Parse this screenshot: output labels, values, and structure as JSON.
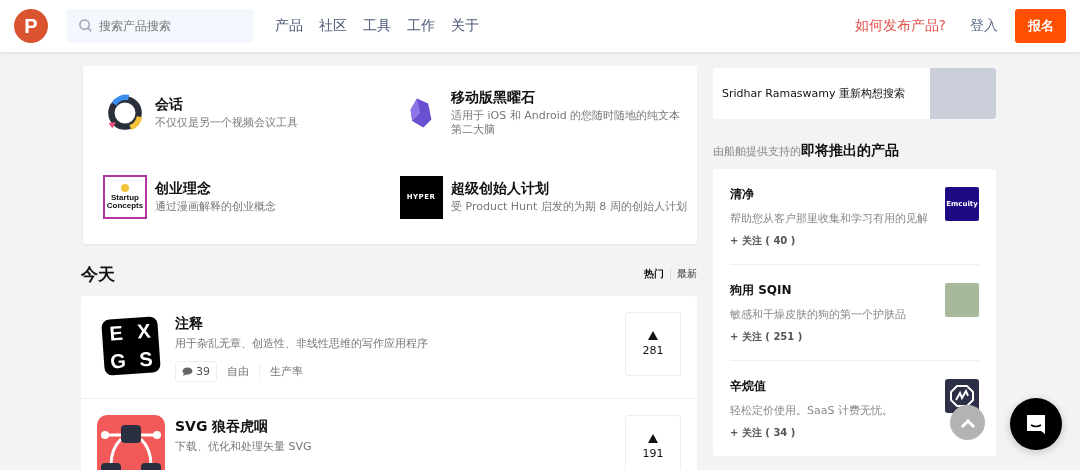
{
  "header": {
    "logo": "P",
    "search": {
      "placeholder": "搜索产品搜索"
    },
    "nav": [
      "产品",
      "社区",
      "工具",
      "工作",
      "关于"
    ],
    "how_to_launch": "如何发布产品?",
    "login": "登入",
    "signup": "报名"
  },
  "featured": [
    {
      "kind": "ring",
      "title": "会话",
      "desc": "不仅仅是另一个视频会议工具"
    },
    {
      "kind": "gem",
      "title": "移动版黑曜石",
      "desc": "适用于 iOS 和 Android 的您随时随地的纯文本第二大脑"
    },
    {
      "kind": "concepts",
      "title": "创业理念",
      "desc": "通过漫画解释的创业概念",
      "logo_text": [
        "Startup",
        "Concepts"
      ]
    },
    {
      "kind": "hyper",
      "title": "超级创始人计划",
      "desc": "受 Product Hunt 启发的为期 8 周的创始人计划",
      "logo_text": [
        "HYPER"
      ]
    }
  ],
  "today": {
    "title": "今天",
    "tabs": [
      {
        "label": "热门",
        "selected": true
      },
      {
        "label": "最新",
        "selected": false
      }
    ],
    "products": [
      {
        "kind": "exgs",
        "title": "注释",
        "desc": "用于杂乱无章、创造性、非线性思维的写作应用程序",
        "logo_text": [
          "E",
          "X",
          "G",
          "S"
        ],
        "comments": "39",
        "tags": [
          "自由",
          "生产率"
        ],
        "votes": "281"
      },
      {
        "kind": "svg",
        "title": "SVG 狼吞虎咽",
        "desc": "下载、优化和处理矢量 SVG",
        "votes": "191"
      }
    ]
  },
  "story": {
    "title": "Sridhar Ramaswamy 重新构想搜索"
  },
  "upcoming": {
    "prefix": "由船舶提供支持的",
    "title": "即将推出的产品",
    "items": [
      {
        "kind": "emcuity",
        "title": "清净",
        "desc": "帮助您从客户那里收集和学习有用的见解",
        "follow": "+ 关注 ( 40 )",
        "logo_text": "Emcuity"
      },
      {
        "kind": "photo",
        "title": "狗用 SQIN",
        "desc": "敏感和干燥皮肤的狗的第一个护肤品",
        "follow": "+ 关注 ( 251 )"
      },
      {
        "kind": "badge",
        "title": "辛烷值",
        "desc": "轻松定价使用。SaaS 计费无忧。",
        "follow": "+ 关注 ( 34 )"
      }
    ]
  }
}
